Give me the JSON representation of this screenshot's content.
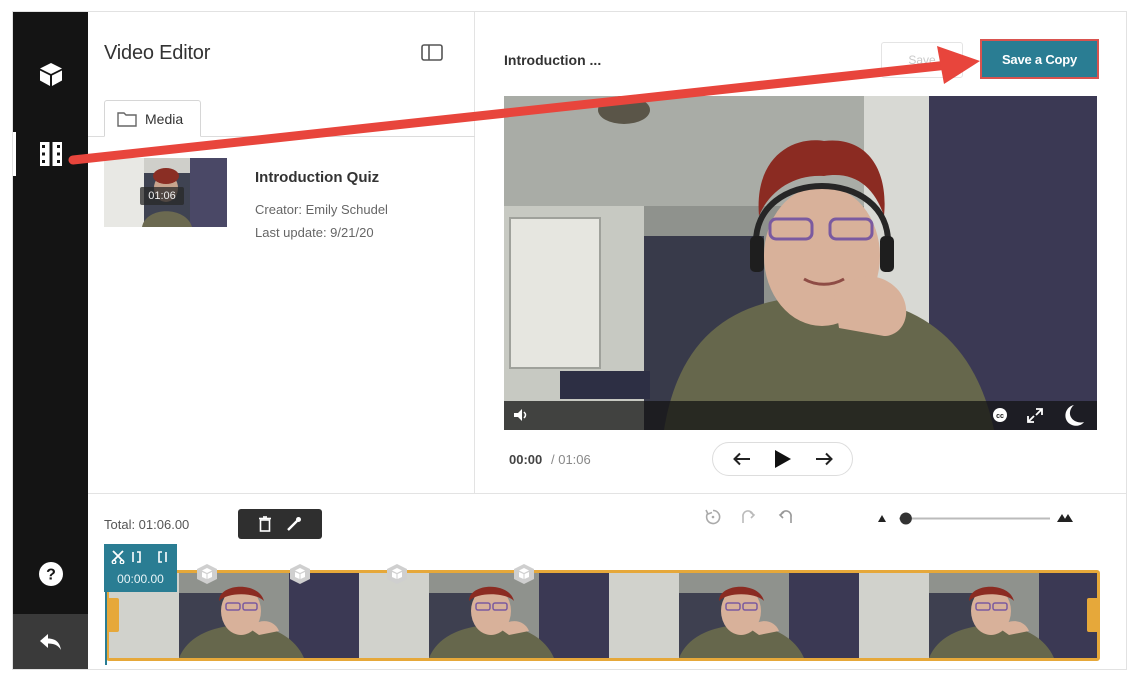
{
  "panel": {
    "title": "Video Editor",
    "tab_media": "Media"
  },
  "entry": {
    "title": "Introduction Quiz",
    "creator": "Creator: Emily Schudel",
    "last_update": "Last update: 9/21/20",
    "duration": "01:06"
  },
  "main": {
    "video_title": "Introduction ...",
    "save_label": "Save",
    "save_copy_label": "Save a Copy",
    "current_time": "00:00",
    "total_time": "/  01:06"
  },
  "timeline": {
    "total_label": "Total: 01:06.00",
    "cut_time": "00:00.00",
    "zoom_level": 0.02
  },
  "colors": {
    "accent": "#2a7d93",
    "highlight_arrow": "#e8453c",
    "strip_border": "#e6a83a"
  },
  "icons": {
    "rail": [
      "cube-icon",
      "film-icon",
      "help-icon",
      "back-arrow-icon"
    ],
    "timeline": [
      "delete-icon",
      "split-icon",
      "reset-icon",
      "redo-icon",
      "undo-icon"
    ]
  }
}
